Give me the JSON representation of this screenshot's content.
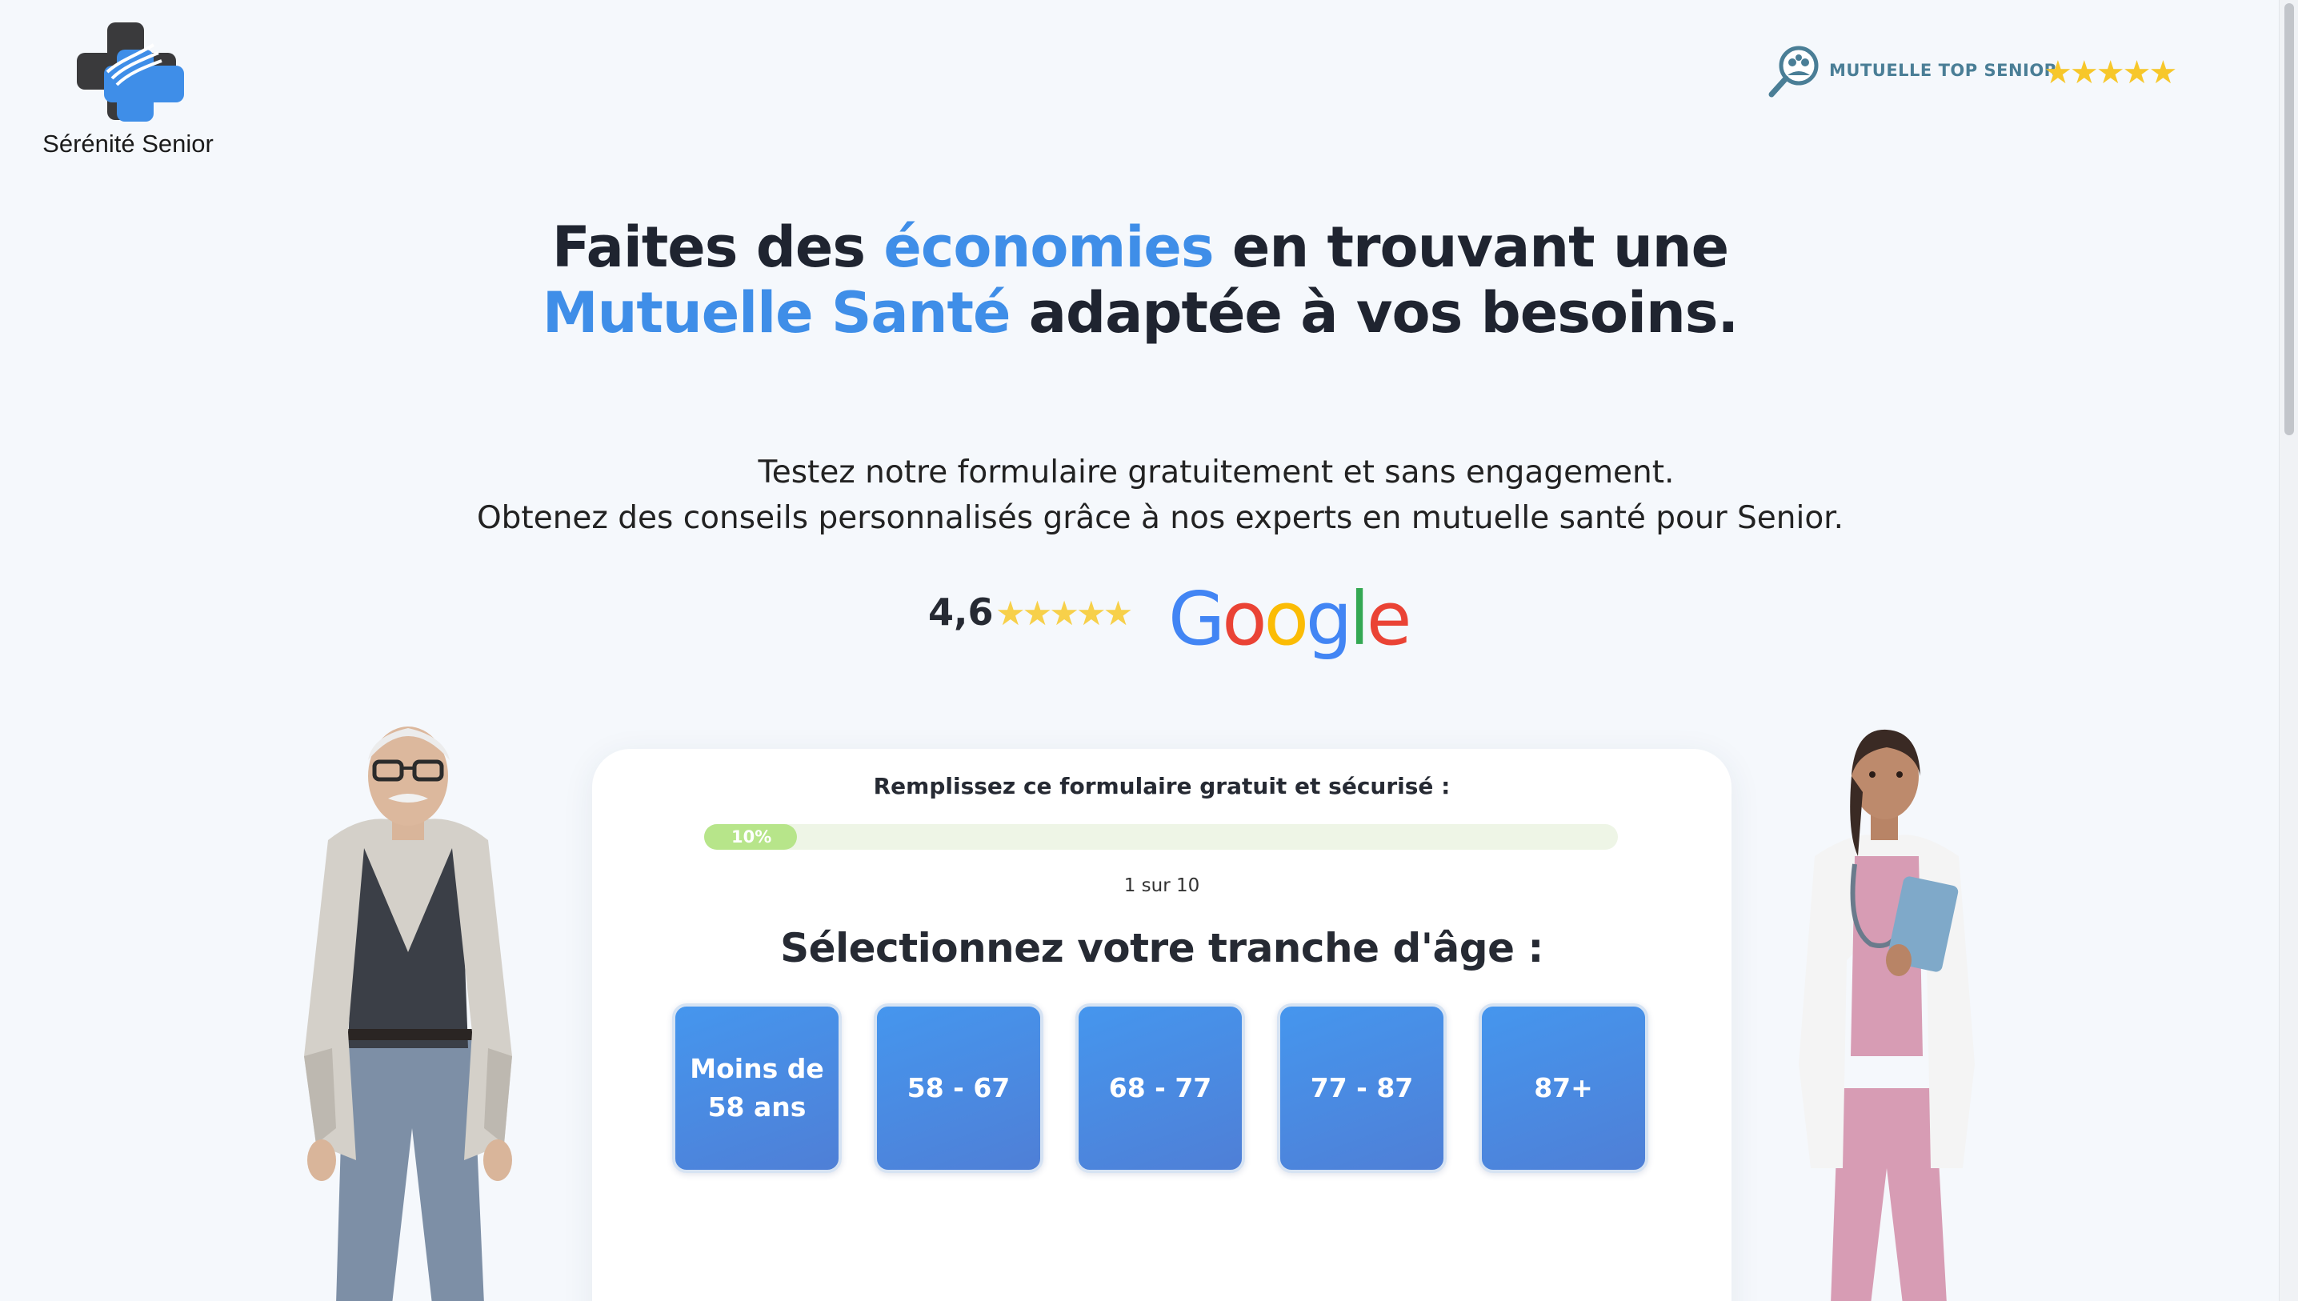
{
  "brand": {
    "name": "Sérénité Senior",
    "colors": {
      "accent": "#3f8ee8",
      "dark": "#1f2430",
      "logo_dark": "#3a3a3c",
      "logo_blue": "#3f8ee8"
    }
  },
  "badge": {
    "label": "MUTUELLE TOP SENIOR",
    "stars": "★★★★★",
    "icon": "magnifier-people-icon"
  },
  "headline": {
    "part1": "Faites des ",
    "highlight1": "économies",
    "part2": " en trouvant une",
    "highlight2": "Mutuelle Santé",
    "part3": " adaptée à vos besoins."
  },
  "subtitle": {
    "line1": "Testez notre formulaire gratuitement et sans engagement.",
    "line2": "Obtenez des conseils personnalisés grâce à nos experts en mutuelle santé pour Senior."
  },
  "rating": {
    "score": "4,6",
    "stars": "★★★★★",
    "provider_letters": [
      "G",
      "o",
      "o",
      "g",
      "l",
      "e"
    ]
  },
  "form": {
    "title": "Remplissez ce formulaire gratuit et sécurisé :",
    "progress_percent": 10,
    "progress_label": "10%",
    "step_text": "1 sur 10",
    "question": "Sélectionnez votre tranche d'âge :",
    "options": [
      {
        "label": "Moins de 58 ans"
      },
      {
        "label": "58 - 67"
      },
      {
        "label": "68 - 77"
      },
      {
        "label": "77 - 87"
      },
      {
        "label": "87+"
      }
    ],
    "colors": {
      "option_bg": "#4596ee",
      "progress_fill": "#b7e58a",
      "progress_track": "#eef5e6"
    }
  },
  "illustrations": {
    "left": "senior-man-illustration",
    "right": "doctor-woman-illustration"
  }
}
